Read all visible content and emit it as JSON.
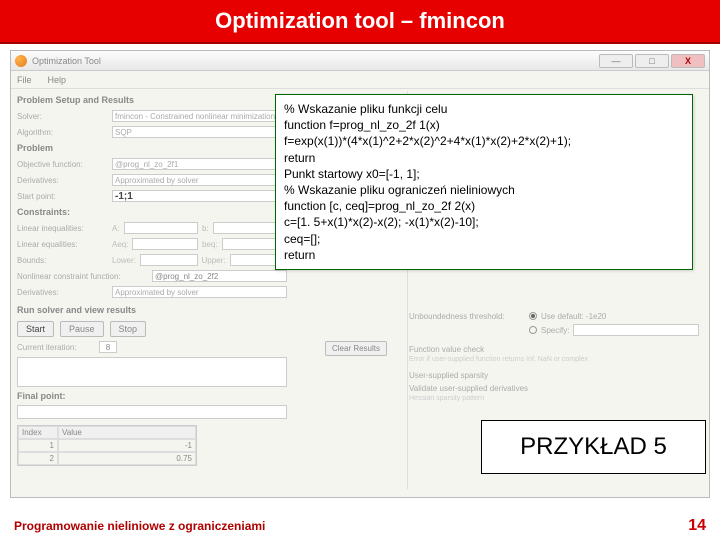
{
  "header": {
    "title": "Optimization tool – fmincon"
  },
  "window": {
    "title": "Optimization Tool",
    "menu": [
      "File",
      "Help"
    ],
    "winbuttons": {
      "min": "—",
      "max": "□",
      "close": "X"
    }
  },
  "left": {
    "section": "Problem Setup and Results",
    "solver_lbl": "Solver:",
    "solver_val": "fmincon - Constrained nonlinear minimization",
    "algo_lbl": "Algorithm:",
    "algo_val": "SQP",
    "problem_lbl": "Problem",
    "obj_lbl": "Objective function:",
    "obj_val": "@prog_nl_zo_2f1",
    "deriv_lbl": "Derivatives:",
    "deriv_val": "Approximated by solver",
    "start_lbl": "Start point:",
    "start_val": "-1;1",
    "constraints_lbl": "Constraints:",
    "lineq_lbl": "Linear inequalities:",
    "A": "A:",
    "b": "b:",
    "leq_lbl": "Linear equalities:",
    "Aeq": "Aeq:",
    "beq": "beq:",
    "bounds_lbl": "Bounds:",
    "lower": "Lower:",
    "upper": "Upper:",
    "nlcon_lbl": "Nonlinear constraint function:",
    "nlcon_val": "@prog_nl_zo_2f2",
    "nlderiv_lbl": "Derivatives:",
    "nlderiv_val": "Approximated by solver",
    "run_lbl": "Run solver and view results",
    "buttons": {
      "start": "Start",
      "pause": "Pause",
      "stop": "Stop"
    },
    "iter_lbl": "Current iteration:",
    "iter_val": "8",
    "clear": "Clear Results",
    "final_lbl": "Final point:",
    "table": {
      "idx_h": "Index",
      "val_h": "Value",
      "r1i": "1",
      "r1v": "-1",
      "r2i": "2",
      "r2v": "0.75"
    }
  },
  "right": {
    "unbound_lbl": "Unboundedness threshold:",
    "opt1": "Use default: -1e20",
    "opt2": "Specify:",
    "fcheck": "Function value check",
    "fcheck_detail": "Error if user-supplied function returns Inf, NaN or complex",
    "sparse_lbl": "User-supplied sparsity",
    "hess_lbl": "Validate user-supplied derivatives",
    "hess_pattern": "Hessian sparsity pattern"
  },
  "code": {
    "l1": "% Wskazanie pliku funkcji celu",
    "l2": "function f=prog_nl_zo_2f 1(x)",
    "l3": "f=exp(x(1))*(4*x(1)^2+2*x(2)^2+4*x(1)*x(2)+2*x(2)+1);",
    "l4": "return",
    "l5": "Punkt startowy x0=[-1, 1];",
    "l6": "% Wskazanie pliku ograniczeń nieliniowych",
    "l7": "function [c, ceq]=prog_nl_zo_2f 2(x)",
    "l8": "c=[1. 5+x(1)*x(2)-x(2); -x(1)*x(2)-10];",
    "l9": "ceq=[];",
    "l10": "return"
  },
  "example": {
    "label": "PRZYKŁAD 5"
  },
  "footer": {
    "left": "Programowanie nieliniowe z ograniczeniami",
    "right": "14"
  }
}
